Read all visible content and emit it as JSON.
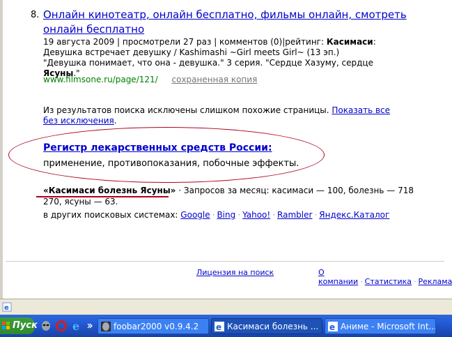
{
  "result": {
    "number": "8.",
    "title": "Онлайн кинотеатр, онлайн бесплатно, фильмы онлайн, смотреть онлайн бесплатно",
    "snippet_line1_prefix": "19 августа 2009 | просмотрели 27 раз | комментов (0)|рейтинг: ",
    "snippet_bold1": "Касимаси",
    "snippet_line1_suffix": ": Девушка встречает девушку / Kashimashi ~Girl meets Girl~ (13 эп.)",
    "snippet_line2_prefix": "\"Девушка понимает, что она - девушка.\" 3 серия. \"Сердце Хазуму, сердце ",
    "snippet_bold2": "Ясуны",
    "snippet_line2_suffix": ".\"",
    "url": "www.filmsone.ru/page/121/",
    "cache_label": "сохраненная копия"
  },
  "excluded": {
    "text": "Из результатов поиска исключены слишком похожие страницы. ",
    "link": "Показать все без исключения",
    "end": "."
  },
  "ad": {
    "title": "Регистр лекарственных средств России:",
    "description": "применение, противопоказания, побочные эффекты."
  },
  "query_stats": {
    "query": "«Касимаси болезнь Ясуны»",
    "separator": " · ",
    "text": "Запросов за месяц: касимаси — 100, болезнь — 718 270, ясуны — 63."
  },
  "other_engines": {
    "label": "в других поисковых системах: ",
    "links": [
      "Google",
      "Bing",
      "Yahoo!",
      "Rambler",
      "Яндекс.Каталог"
    ]
  },
  "footer": {
    "license": "Лицензия на поиск",
    "links": [
      "О компании",
      "Статистика",
      "Реклама"
    ]
  },
  "taskbar": {
    "start_label": "Пуск",
    "tasks": [
      {
        "label": "foobar2000 v0.9.4.2"
      },
      {
        "label": "Касимаси болезнь ..."
      },
      {
        "label": "Аниме - Microsoft Int..."
      }
    ]
  },
  "colors": {
    "link": "#0000cc",
    "url": "#008000",
    "annotation": "#b0001e",
    "taskbar": "#245edb"
  }
}
